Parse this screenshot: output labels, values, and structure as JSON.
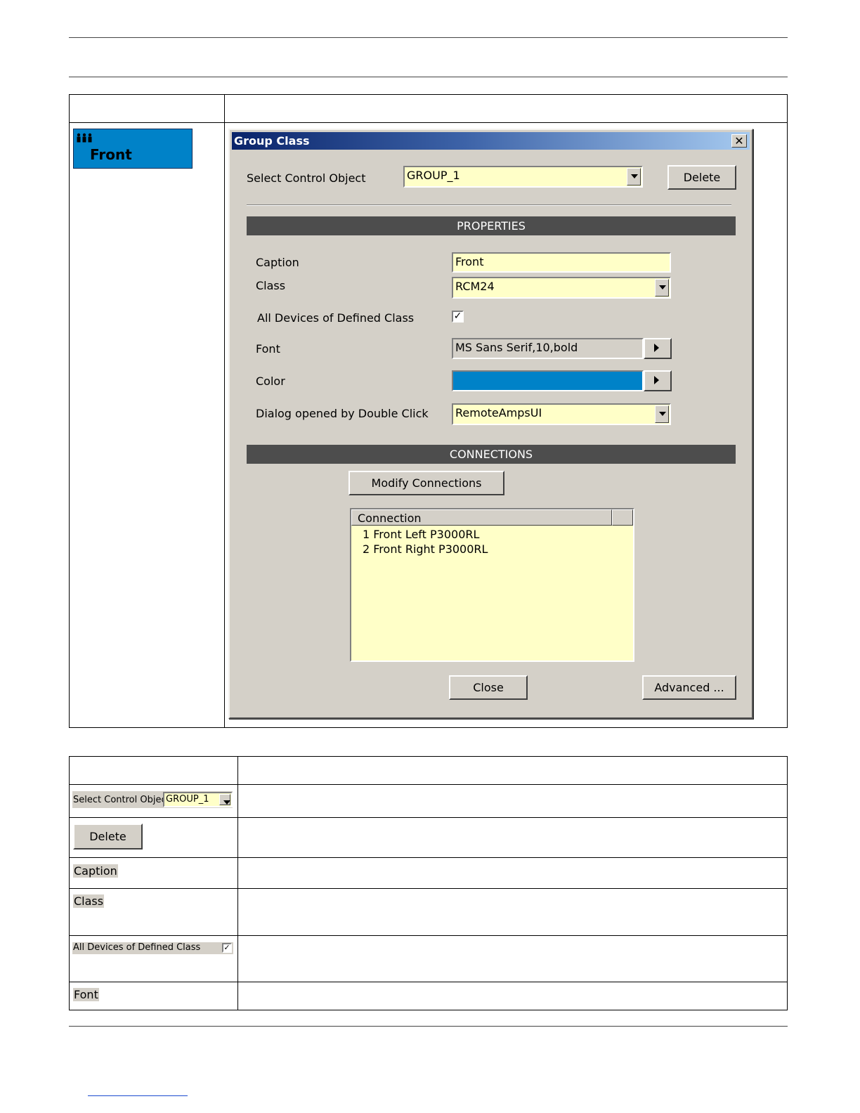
{
  "group_widget": {
    "caption": "Front",
    "color": "#0082c8"
  },
  "dialog": {
    "title": "Group Class",
    "close_glyph": "✕",
    "select_label": "Select Control Object",
    "select_value": "GROUP_1",
    "delete_label": "Delete",
    "properties_header": "PROPERTIES",
    "caption_label": "Caption",
    "caption_value": "Front",
    "class_label": "Class",
    "class_value": "RCM24",
    "all_devices_label": "All Devices of Defined Class",
    "all_devices_checked": "✓",
    "font_label": "Font",
    "font_value": "MS Sans Serif,10,bold",
    "color_label": "Color",
    "color_value": "#0082c8",
    "dblclick_label": "Dialog opened by Double Click",
    "dblclick_value": "RemoteAmpsUI",
    "connections_header": "CONNECTIONS",
    "modify_label": "Modify Connections",
    "list_header": "Connection",
    "connections": [
      "1 Front Left P3000RL",
      "2 Front Right P3000RL"
    ],
    "close_label": "Close",
    "advanced_label": "Advanced ..."
  },
  "param_table": {
    "select_label": "Select Control Object",
    "select_value": "GROUP_1",
    "delete_label": "Delete",
    "caption_label": "Caption",
    "class_label": "Class",
    "all_devices_label": "All Devices of Defined Class",
    "all_devices_checked": "✓",
    "font_label": "Font"
  }
}
